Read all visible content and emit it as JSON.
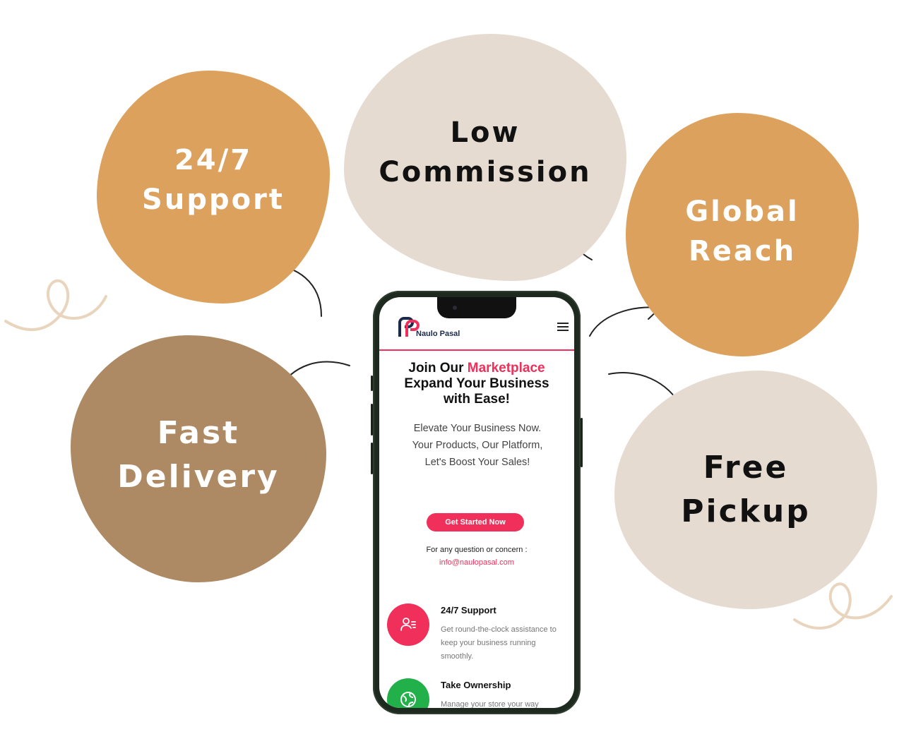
{
  "colors": {
    "orange_blob": "#dca15d",
    "beige_blob": "#e5dbd0",
    "brown_blob": "#ad8a64",
    "accent_pink": "#f0305a",
    "green_icon": "#22b04a",
    "doodle": "#e9d5bd"
  },
  "bubbles": {
    "support": {
      "line1": "24/7",
      "line2": "Support"
    },
    "commission": {
      "line1": "Low",
      "line2": "Commission"
    },
    "global": {
      "line1": "Global",
      "line2": "Reach"
    },
    "fast": {
      "line1": "Fast",
      "line2": "Delivery"
    },
    "pickup": {
      "line1": "Free",
      "line2": "Pickup"
    }
  },
  "phone": {
    "header": {
      "brand": "Naulo Pasal",
      "menu_icon": "hamburger-menu-icon"
    },
    "hero": {
      "title_prefix": "Join Our ",
      "title_accent": "Marketplace",
      "title_line2": "Expand Your Business",
      "title_line3": "with Ease!",
      "description": "Elevate Your Business Now. Your Products, Our Platform, Let's Boost Your Sales!",
      "cta_label": "Get Started Now"
    },
    "contact": {
      "question": "For any question or concern :",
      "email": "info@naulopasal.com"
    },
    "features": [
      {
        "title": "24/7 Support",
        "description": "Get round-the-clock assistance to keep your business running smoothly.",
        "icon": "support-agent-icon"
      },
      {
        "title": "Take Ownership",
        "description": "Manage your store your way",
        "icon": "globe-icon"
      }
    ]
  }
}
